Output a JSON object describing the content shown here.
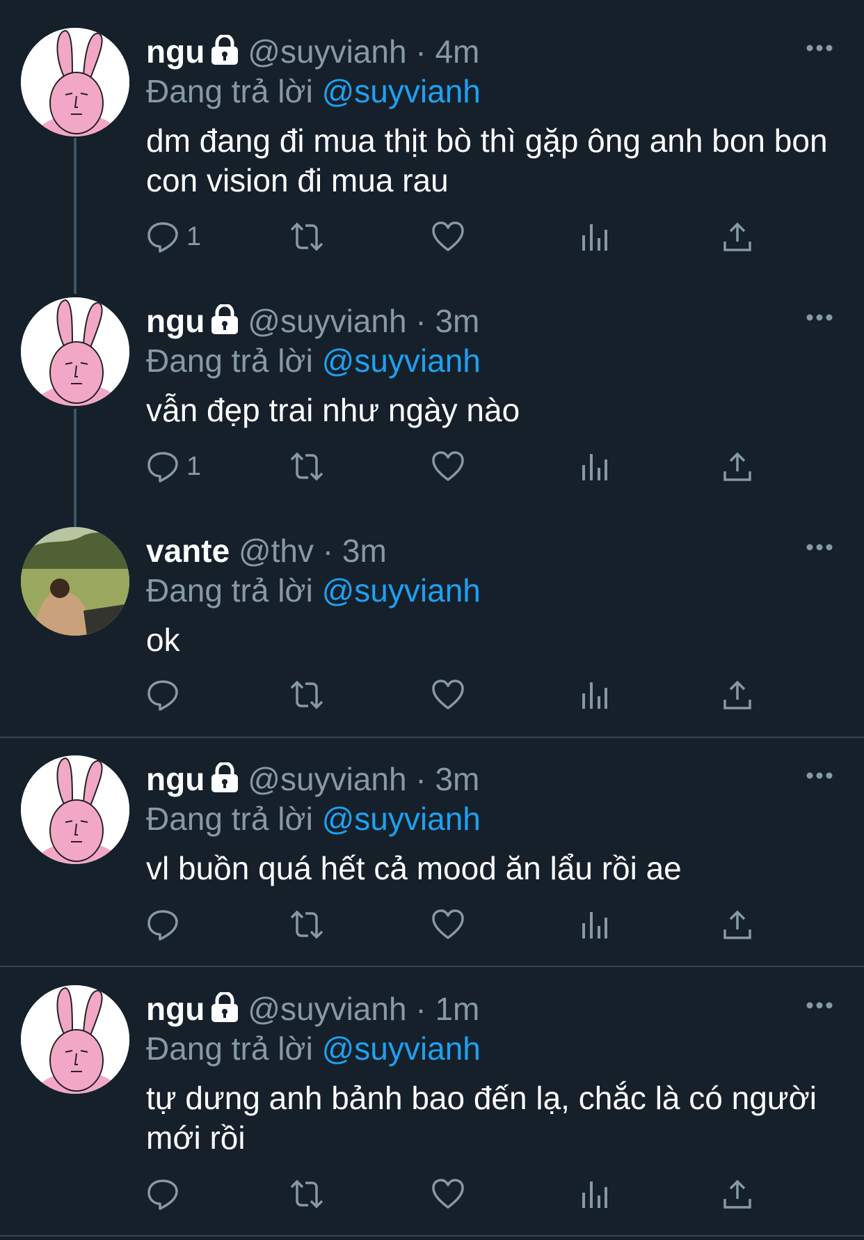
{
  "reply_prefix": "Đang trả lời",
  "tweets": [
    {
      "name": "ngu",
      "handle": "@suyvianh",
      "separator": "·",
      "time": "4m",
      "reply_to": "@suyvianh",
      "text": "dm đang đi mua thịt bò thì gặp ông anh bon bon con vision đi mua rau",
      "reply_count": "1",
      "locked": true
    },
    {
      "name": "ngu",
      "handle": "@suyvianh",
      "separator": "·",
      "time": "3m",
      "reply_to": "@suyvianh",
      "text": "vẫn đẹp trai như ngày nào",
      "reply_count": "1",
      "locked": true
    },
    {
      "name": "vante",
      "handle": "@thv",
      "separator": "·",
      "time": "3m",
      "reply_to": "@suyvianh",
      "text": "ok",
      "reply_count": "",
      "locked": false
    },
    {
      "name": "ngu",
      "handle": "@suyvianh",
      "separator": "·",
      "time": "3m",
      "reply_to": "@suyvianh",
      "text": "vl buồn quá hết cả mood ăn lẩu rồi ae",
      "reply_count": "",
      "locked": true
    },
    {
      "name": "ngu",
      "handle": "@suyvianh",
      "separator": "·",
      "time": "1m",
      "reply_to": "@suyvianh",
      "text": "tự dưng anh bảnh bao đến lạ, chắc là có người mới rồi",
      "reply_count": "",
      "locked": true
    }
  ],
  "icons": {
    "reply": "reply-icon",
    "retweet": "retweet-icon",
    "like": "heart-icon",
    "analytics": "analytics-icon",
    "share": "share-icon",
    "more": "more-icon",
    "lock": "lock-icon"
  },
  "colors": {
    "background": "#15202b",
    "secondary": "#8899a6",
    "accent": "#1da1f2",
    "divider": "#38444d"
  }
}
